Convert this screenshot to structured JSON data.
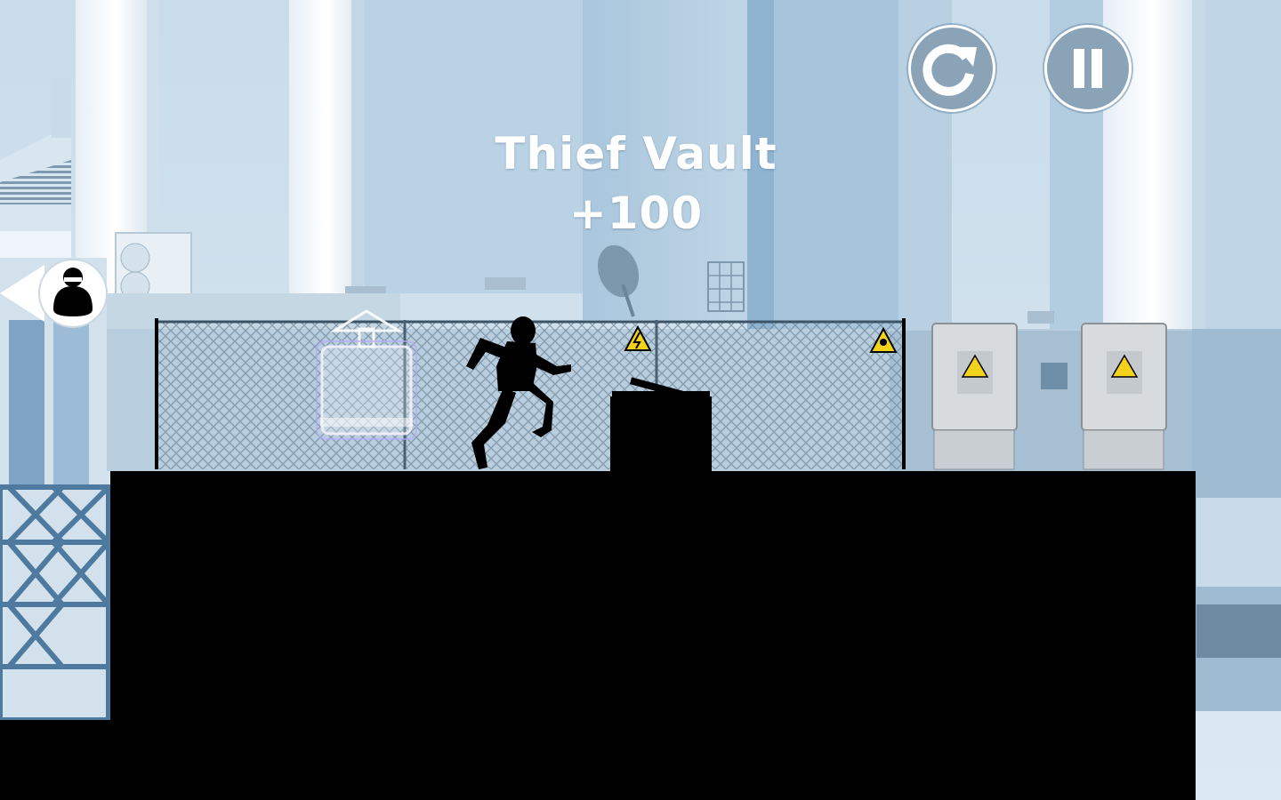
{
  "popup": {
    "title": "Thief Vault",
    "points": "+100"
  },
  "hud": {
    "restart_icon": "restart-icon",
    "pause_icon": "pause-icon",
    "chaser_icon": "hunter-silhouette-icon"
  },
  "colors": {
    "sky": "#cfe1ee",
    "silhouette": "#000000",
    "button_fill": "#8aa3b7",
    "warning_yellow": "#f2d21b"
  }
}
